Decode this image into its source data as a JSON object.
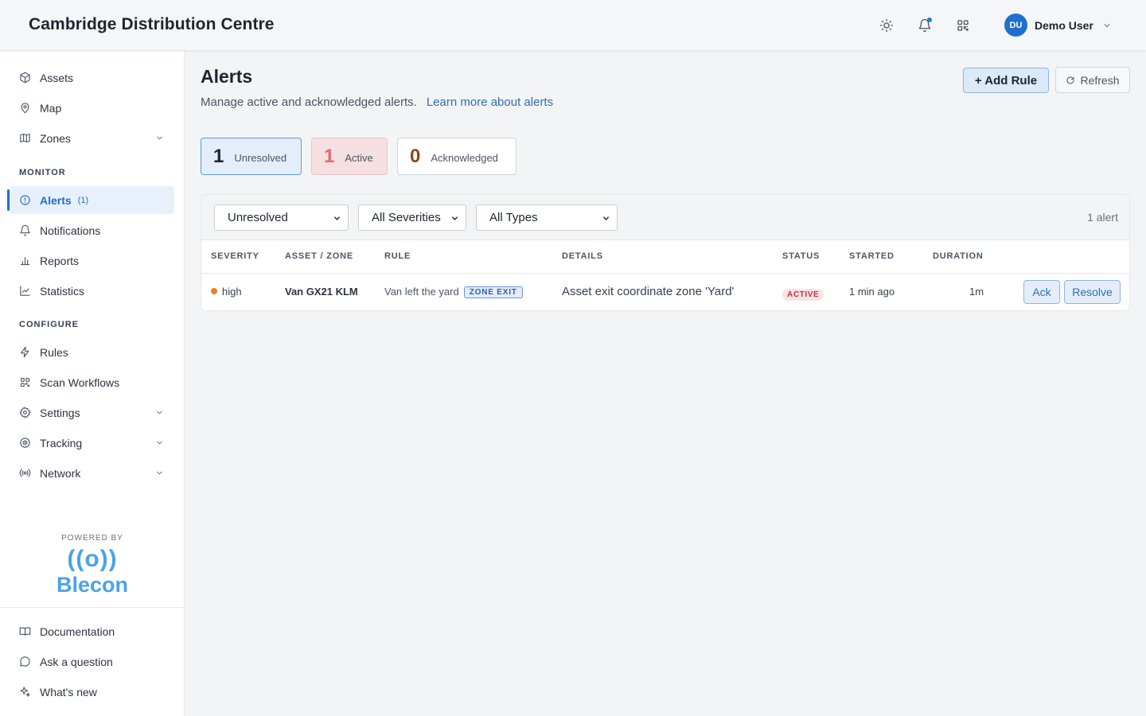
{
  "header": {
    "title": "Cambridge Distribution Centre",
    "user_initials": "DU",
    "user_name": "Demo User",
    "icons": [
      "sun-icon",
      "bell-icon",
      "qr-code-icon",
      "chevron-down-icon"
    ]
  },
  "sidebar": {
    "items_top": [
      {
        "label": "Assets",
        "icon": "box-icon"
      },
      {
        "label": "Map",
        "icon": "map-pin-icon"
      },
      {
        "label": "Zones",
        "icon": "map-icon",
        "expandable": true
      }
    ],
    "monitor_label": "MONITOR",
    "monitor_items": [
      {
        "label": "Alerts",
        "count": "(1)",
        "icon": "alert-circle-icon",
        "active": true
      },
      {
        "label": "Notifications",
        "icon": "bell-icon"
      },
      {
        "label": "Reports",
        "icon": "bar-chart-icon"
      },
      {
        "label": "Statistics",
        "icon": "line-chart-icon"
      }
    ],
    "configure_label": "CONFIGURE",
    "configure_items": [
      {
        "label": "Rules",
        "icon": "zap-icon"
      },
      {
        "label": "Scan Workflows",
        "icon": "qr-code-icon"
      },
      {
        "label": "Settings",
        "icon": "gear-icon",
        "expandable": true
      },
      {
        "label": "Tracking",
        "icon": "target-icon",
        "expandable": true
      },
      {
        "label": "Network",
        "icon": "radio-icon",
        "expandable": true
      }
    ],
    "powered_by": "POWERED BY",
    "brand_glyph": "((o))",
    "brand_name": "Blecon",
    "footer_items": [
      {
        "label": "Documentation",
        "icon": "book-icon"
      },
      {
        "label": "Ask a question",
        "icon": "message-circle-icon"
      },
      {
        "label": "What's new",
        "icon": "sparkles-icon"
      }
    ]
  },
  "main": {
    "title": "Alerts",
    "subtitle": "Manage active and acknowledged alerts.",
    "learn_link": "Learn more about alerts",
    "add_rule_label": "+ Add Rule",
    "refresh_label": "Refresh",
    "stats": [
      {
        "value": "1",
        "label": "Unresolved"
      },
      {
        "value": "1",
        "label": "Active"
      },
      {
        "value": "0",
        "label": "Acknowledged"
      }
    ],
    "filters": {
      "status": "Unresolved",
      "severity": "All Severities",
      "type": "All Types"
    },
    "count_text": "1 alert",
    "table": {
      "headers": [
        "SEVERITY",
        "ASSET / ZONE",
        "RULE",
        "DETAILS",
        "STATUS",
        "STARTED",
        "DURATION"
      ],
      "rows": [
        {
          "severity": "high",
          "asset": "Van GX21 KLM",
          "rule": "Van left the yard",
          "rule_type": "ZONE EXIT",
          "details": "Asset exit coordinate zone 'Yard'",
          "status": "ACTIVE",
          "started": "1 min ago",
          "duration": "1m",
          "ack_label": "Ack",
          "resolve_label": "Resolve"
        }
      ]
    }
  },
  "colors": {
    "accent": "#1d6fd1",
    "brand": "#4aa3e8",
    "severity_high": "#f07f25",
    "status_active": "#c2323b"
  }
}
